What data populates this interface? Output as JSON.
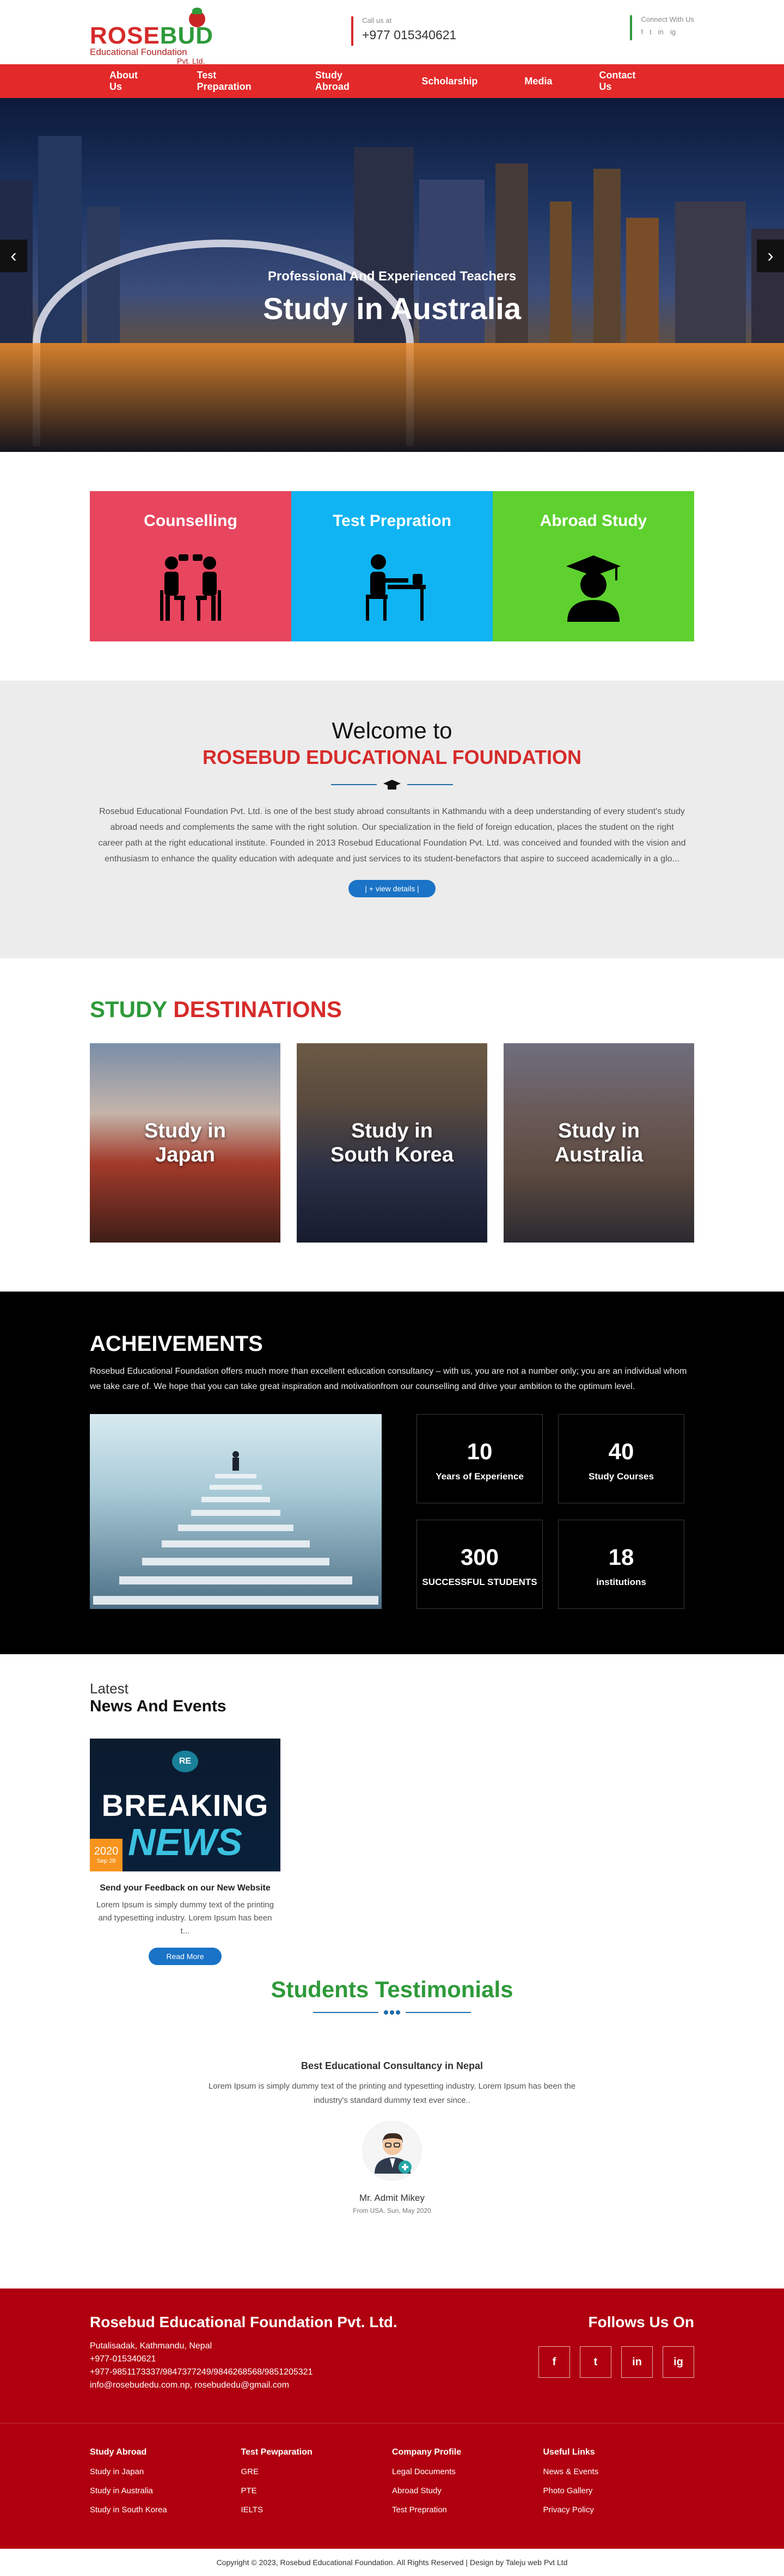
{
  "header": {
    "logo": {
      "rose": "ROSE",
      "bud": "BUD",
      "line2": "Educational Foundation",
      "line3": "Pvt. Ltd."
    },
    "call_label": "Call us at",
    "phone": "+977 015340621",
    "connect_label": "Connect With Us",
    "socials": [
      "f",
      "t",
      "in",
      "ig"
    ]
  },
  "nav": [
    "About Us",
    "Test Preparation",
    "Study Abroad",
    "Scholarship",
    "Media",
    "Contact Us"
  ],
  "hero": {
    "subtitle": "Professional And Experienced Teachers",
    "title": "Study in Australia",
    "prev": "‹",
    "next": "›"
  },
  "services": [
    {
      "label": "Counselling",
      "color": "#e8455f",
      "icon": "counselling-icon"
    },
    {
      "label": "Test Prepration",
      "color": "#10b4f2",
      "icon": "study-desk-icon"
    },
    {
      "label": "Abroad Study",
      "color": "#5ed12f",
      "icon": "graduate-icon"
    }
  ],
  "welcome": {
    "heading": "Welcome to",
    "org": "ROSEBUD EDUCATIONAL FOUNDATION",
    "text": "Rosebud Educational Foundation Pvt. Ltd. is one of the best study abroad consultants in Kathmandu with a deep understanding of every student's study abroad needs and complements the same with the right solution. Our specialization in the field of foreign education, places the student on the right career path at the right educational institute.  Founded in 2013 Rosebud Educational Foundation Pvt. Ltd. was conceived and founded with the vision and enthusiasm to enhance the quality education with adequate and just services to its student-benefactors that aspire to succeed academically in a glo...",
    "button": "| + view details |"
  },
  "destinations": {
    "title_green": "STUDY",
    "title_red": "DESTINATIONS",
    "cards": [
      {
        "line1": "Study in",
        "line2": "Japan"
      },
      {
        "line1": "Study in",
        "line2": "South Korea"
      },
      {
        "line1": "Study in",
        "line2": "Australia"
      }
    ]
  },
  "achievements": {
    "title": "ACHEIVEMENTS",
    "text": "Rosebud Educational Foundation offers much more than excellent education consultancy – with us, you are not a number only; you are an individual whom we take care of. We hope that you can take great inspiration and motivationfrom our counselling and drive your ambition to the optimum level.",
    "stats": [
      {
        "num": "10",
        "label": "Years of Experience"
      },
      {
        "num": "40",
        "label": "Study Courses"
      },
      {
        "num": "300",
        "label": "SUCCESSFUL STUDENTS"
      },
      {
        "num": "18",
        "label": "institutions"
      }
    ]
  },
  "news": {
    "latest": "Latest",
    "title": "News And Events",
    "item": {
      "breaking": "BREAKING",
      "news_word": "NEWS",
      "logo": "RE",
      "badge_year": "2020",
      "badge_date": "Sep 28",
      "headline": "Send your Feedback on our New Website",
      "desc": "Lorem Ipsum is simply dummy text of the printing and typesetting industry. Lorem Ipsum has been t...",
      "button": "Read More"
    }
  },
  "testimonials": {
    "title": "Students Testimonials",
    "quote_title": "Best Educational Consultancy in Nepal",
    "quote": "Lorem Ipsum is simply dummy text of the printing and typesetting industry. Lorem Ipsum has been the industry's standard dummy text ever since..",
    "name": "Mr. Admit Mikey",
    "from": "From USA, Sun, May 2020"
  },
  "footer": {
    "org": "Rosebud Educational Foundation Pvt. Ltd.",
    "address": "Putalisadak, Kathmandu, Nepal",
    "phone1": "+977-015340621",
    "phone2": "+977-9851173337/9847377249/9846268568/9851205321",
    "email": "info@rosebudedu.com.np, rosebudedu@gmail.com",
    "follow": "Follows Us On",
    "social": [
      "f",
      "t",
      "in",
      "ig"
    ],
    "columns": [
      {
        "title": "Study Abroad",
        "links": [
          "Study in Japan",
          "Study in Australia",
          "Study in South Korea"
        ]
      },
      {
        "title": "Test Pewparation",
        "links": [
          "GRE",
          "PTE",
          "IELTS"
        ]
      },
      {
        "title": "Company Profile",
        "links": [
          "Legal Documents",
          "Abroad Study",
          "Test Prepration"
        ]
      },
      {
        "title": "Useful Links",
        "links": [
          "News & Events",
          "Photo Gallery",
          "Privacy Policy"
        ]
      }
    ],
    "copyright": "Copyright © 2023, Rosebud Educational Foundation. All Rights Reserved | Design by Taleju web Pvt Ltd"
  }
}
